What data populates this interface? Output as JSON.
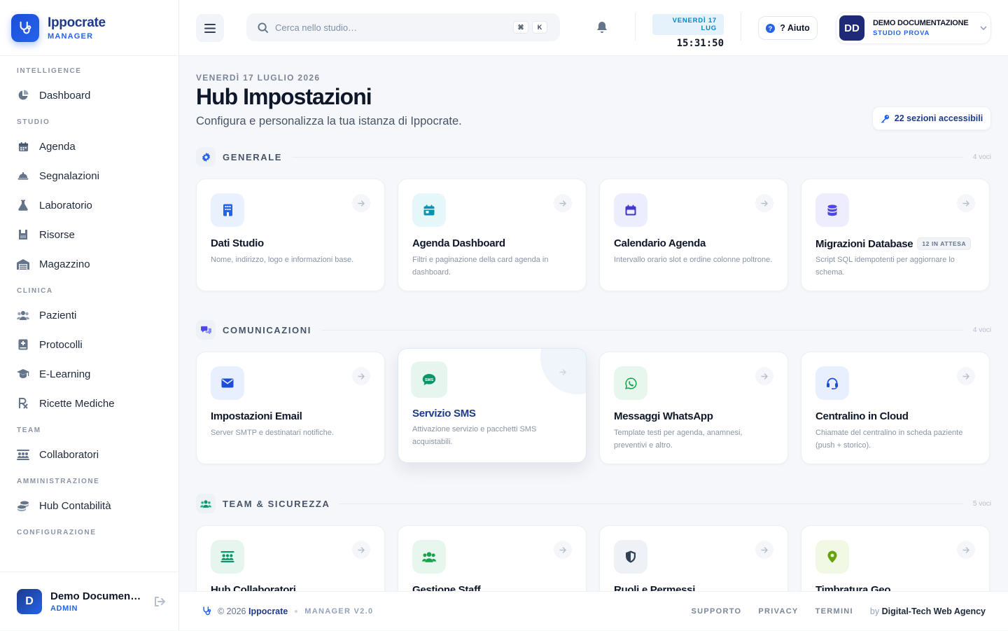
{
  "brand": {
    "name": "Ippocrate",
    "sub": "MANAGER"
  },
  "sidebar": {
    "sections": [
      {
        "title": "INTELLIGENCE",
        "items": [
          {
            "label": "Dashboard",
            "icon": "chart-pie-icon"
          }
        ]
      },
      {
        "title": "STUDIO",
        "items": [
          {
            "label": "Agenda",
            "icon": "calendar-icon"
          },
          {
            "label": "Segnalazioni",
            "icon": "bell-concierge-icon"
          },
          {
            "label": "Laboratorio",
            "icon": "flask-icon"
          },
          {
            "label": "Risorse",
            "icon": "resources-icon"
          },
          {
            "label": "Magazzino",
            "icon": "warehouse-icon"
          }
        ]
      },
      {
        "title": "CLINICA",
        "items": [
          {
            "label": "Pazienti",
            "icon": "users-icon"
          },
          {
            "label": "Protocolli",
            "icon": "medical-book-icon"
          },
          {
            "label": "E-Learning",
            "icon": "graduation-cap-icon"
          },
          {
            "label": "Ricette Mediche",
            "icon": "prescription-icon"
          }
        ]
      },
      {
        "title": "TEAM",
        "items": [
          {
            "label": "Collaboratori",
            "icon": "people-roof-icon"
          }
        ]
      },
      {
        "title": "AMMINISTRAZIONE",
        "items": [
          {
            "label": "Hub Contabilità",
            "icon": "coins-icon"
          }
        ]
      },
      {
        "title": "CONFIGURAZIONE",
        "items": []
      }
    ],
    "user": {
      "initial": "D",
      "name": "Demo Documentazione",
      "role": "ADMIN"
    }
  },
  "topbar": {
    "search_placeholder": "Cerca nello studio…",
    "kbd1": "⌘",
    "kbd2": "K",
    "date_pill": "VENERDÌ 17 LUG",
    "clock": "15:31:50",
    "help_label": "? Aiuto",
    "user": {
      "initials": "DD",
      "name": "DEMO DOCUMENTAZIONE",
      "studio": "STUDIO PROVA"
    }
  },
  "page": {
    "date": "VENERDÌ 17 LUGLIO 2026",
    "title": "Hub Impostazioni",
    "subtitle": "Configura e personalizza la tua istanza di Ippocrate.",
    "sections_badge": "22 sezioni accessibili"
  },
  "sections": [
    {
      "title": "GENERALE",
      "count": "4 voci",
      "cards": [
        {
          "title": "Dati Studio",
          "desc": "Nome, indirizzo, logo e informazioni base.",
          "icon": "building-icon",
          "color": "#2563eb",
          "bg": "#eaf1fe"
        },
        {
          "title": "Agenda Dashboard",
          "desc": "Filtri e paginazione della card agenda in dashboard.",
          "icon": "calendar-day-icon",
          "color": "#0891b2",
          "bg": "#e6f7fa"
        },
        {
          "title": "Calendario Agenda",
          "desc": "Intervallo orario slot e ordine colonne poltrone.",
          "icon": "calendar-icon",
          "color": "#4338ca",
          "bg": "#eceefd"
        },
        {
          "title": "Migrazioni Database",
          "pill": "12 IN ATTESA",
          "desc": "Script SQL idempotenti per aggiornare lo schema.",
          "icon": "database-icon",
          "color": "#4f46e5",
          "bg": "#eeedfd"
        }
      ]
    },
    {
      "title": "COMUNICAZIONI",
      "count": "4 voci",
      "cards": [
        {
          "title": "Impostazioni Email",
          "desc": "Server SMTP e destinatari notifiche.",
          "icon": "envelope-icon",
          "color": "#1d4ed8",
          "bg": "#e8effe"
        },
        {
          "title": "Servizio SMS",
          "desc": "Attivazione servizio e pacchetti SMS acquistabili.",
          "icon": "sms-icon",
          "color": "#059669",
          "bg": "#e6f6ee"
        },
        {
          "title": "Messaggi WhatsApp",
          "desc": "Template testi per agenda, anamnesi, preventivi e altro.",
          "icon": "whatsapp-icon",
          "color": "#16a34a",
          "bg": "#e8f7ee"
        },
        {
          "title": "Centralino in Cloud",
          "desc": "Chiamate del centralino in scheda paziente (push + storico).",
          "icon": "headset-icon",
          "color": "#1d4ed8",
          "bg": "#e8effe"
        }
      ]
    },
    {
      "title": "TEAM & SICUREZZA",
      "count": "5 voci",
      "cards": [
        {
          "title": "Hub Collaboratori",
          "desc": "",
          "icon": "people-roof-icon",
          "color": "#059669",
          "bg": "#e6f6ee"
        },
        {
          "title": "Gestione Staff",
          "desc": "",
          "icon": "users-icon",
          "color": "#16a34a",
          "bg": "#e8f7ee"
        },
        {
          "title": "Ruoli e Permessi",
          "desc": "",
          "icon": "shield-icon",
          "color": "#334155",
          "bg": "#eef1f5"
        },
        {
          "title": "Timbratura Geo",
          "desc": "",
          "icon": "map-pin-icon",
          "color": "#65a30d",
          "bg": "#f1f8e4"
        }
      ]
    }
  ],
  "footer": {
    "copyright_prefix": "© 2026",
    "brand": "Ippocrate",
    "version": "MANAGER V2.0",
    "links": [
      "SUPPORTO",
      "PRIVACY",
      "TERMINI"
    ],
    "by_prefix": "by",
    "agency": "Digital-Tech Web Agency"
  }
}
